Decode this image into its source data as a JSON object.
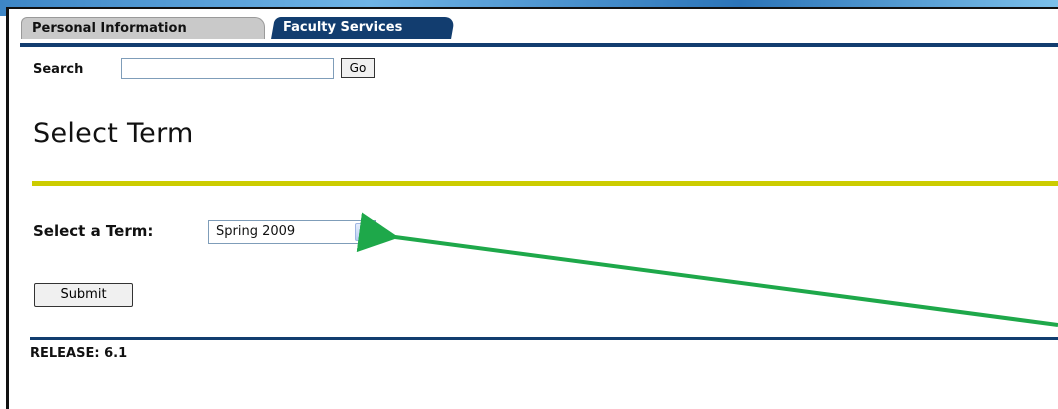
{
  "tabs": {
    "personal_information": "Personal Information",
    "faculty_services": "Faculty Services"
  },
  "search": {
    "label": "Search",
    "value": "",
    "go_label": "Go"
  },
  "page": {
    "title": "Select Term"
  },
  "term_form": {
    "label": "Select a Term:",
    "selected": "Spring 2009",
    "submit_label": "Submit"
  },
  "footer": {
    "release": "RELEASE: 6.1"
  },
  "colors": {
    "nav_blue": "#123d6f",
    "rule_yellow": "#cccc00",
    "annotation_arrow": "#1ea84a"
  },
  "icons": {
    "select_arrow": "chevron-down-icon"
  }
}
